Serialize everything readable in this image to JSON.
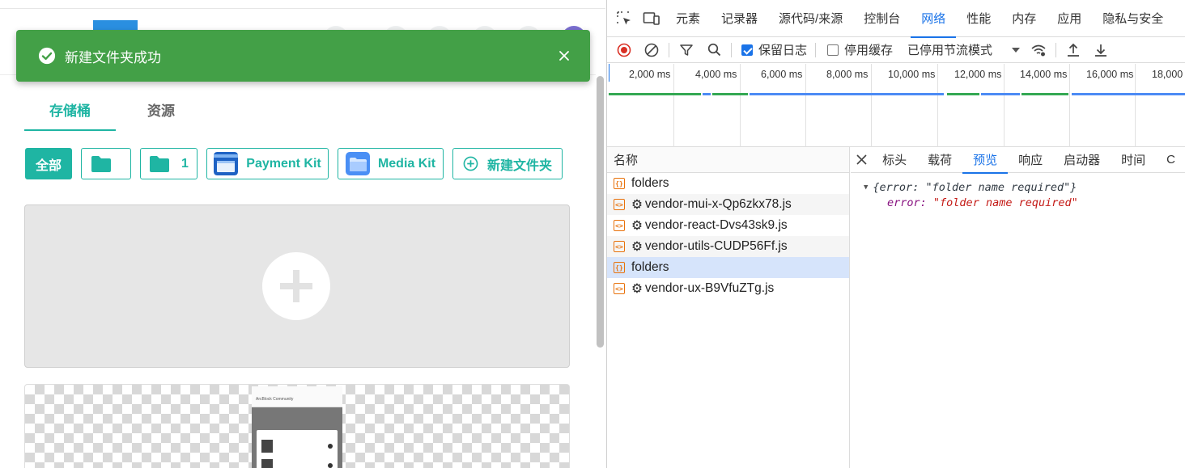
{
  "toast": {
    "message": "新建文件夹成功"
  },
  "app": {
    "tabs": [
      {
        "label": "存储桶",
        "active": true
      },
      {
        "label": "资源",
        "active": false
      }
    ],
    "buckets": [
      {
        "label": "全部",
        "kind": "all"
      },
      {
        "label": "",
        "kind": "folder"
      },
      {
        "label": "1",
        "kind": "folder"
      },
      {
        "label": "Payment Kit",
        "kind": "image"
      },
      {
        "label": "Media Kit",
        "kind": "image"
      },
      {
        "label": "新建文件夹",
        "kind": "new"
      }
    ],
    "phone_preview": {
      "community": "ArcBlock Community"
    }
  },
  "devtools": {
    "tabs": [
      "元素",
      "记录器",
      "源代码/来源",
      "控制台",
      "网络",
      "性能",
      "内存",
      "应用",
      "隐私与安全"
    ],
    "active_tab": "网络",
    "toolbar": {
      "preserve_log": "保留日志",
      "disable_cache": "停用缓存",
      "throttle": "已停用节流模式"
    },
    "timeline_ticks": [
      "2,000 ms",
      "4,000 ms",
      "6,000 ms",
      "8,000 ms",
      "10,000 ms",
      "12,000 ms",
      "14,000 ms",
      "16,000 ms",
      "18,000"
    ],
    "names_header": "名称",
    "requests": [
      {
        "name": "folders",
        "type": "fetch"
      },
      {
        "name": "vendor-mui-x-Qp6zkx78.js",
        "type": "script"
      },
      {
        "name": "vendor-react-Dvs43sk9.js",
        "type": "script"
      },
      {
        "name": "vendor-utils-CUDP56Ff.js",
        "type": "script"
      },
      {
        "name": "folders",
        "type": "fetch"
      },
      {
        "name": "vendor-ux-B9VfuZTg.js",
        "type": "script"
      }
    ],
    "detail_tabs": [
      "标头",
      "载荷",
      "预览",
      "响应",
      "启动器",
      "时间",
      "C"
    ],
    "active_detail_tab": "预览",
    "preview": {
      "summary": "{error: \"folder name required\"}",
      "key": "error:",
      "value": "\"folder name required\""
    }
  },
  "colors": {
    "accent": "#1fb5a3",
    "toast": "#43a047",
    "devtools_blue": "#1a73e8"
  }
}
